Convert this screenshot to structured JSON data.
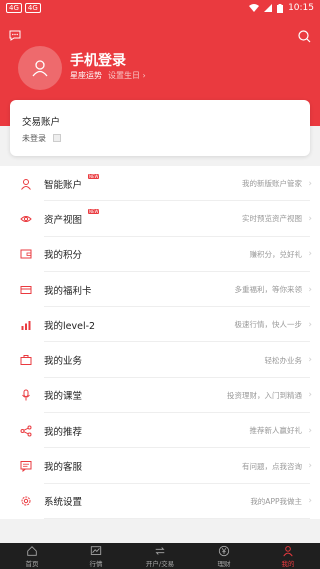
{
  "statusbar": {
    "left_badges": [
      "4G",
      "4G"
    ],
    "time": "10:15"
  },
  "profile": {
    "login_title": "手机登录",
    "horoscope_label": "星座运势",
    "birthday_link": "设置生日"
  },
  "account": {
    "title": "交易账户",
    "status": "未登录"
  },
  "menu": [
    {
      "label": "智能账户",
      "desc": "我的新版账户管家",
      "icon": "person-icon",
      "badge": "NEW"
    },
    {
      "label": "资产视图",
      "desc": "实时预览资产视图",
      "icon": "eye-icon",
      "badge": "NEW"
    },
    {
      "label": "我的积分",
      "desc": "赚积分，兑好礼",
      "icon": "wallet-icon"
    },
    {
      "label": "我的福利卡",
      "desc": "多重福利，等你来领",
      "icon": "card-icon"
    },
    {
      "label": "我的level-2",
      "desc": "极速行情，快人一步",
      "icon": "bar-chart-icon"
    },
    {
      "label": "我的业务",
      "desc": "轻松办业务",
      "icon": "briefcase-icon"
    },
    {
      "label": "我的课堂",
      "desc": "投资理财，入门到精通",
      "icon": "microphone-icon"
    },
    {
      "label": "我的推荐",
      "desc": "推荐新人赢好礼",
      "icon": "share-icon"
    },
    {
      "label": "我的客服",
      "desc": "有问题，点我咨询",
      "icon": "message-icon"
    },
    {
      "label": "系统设置",
      "desc": "我的APP我做主",
      "icon": "gear-icon"
    }
  ],
  "tabs": [
    {
      "label": "首页",
      "icon": "home-icon"
    },
    {
      "label": "行情",
      "icon": "chart-icon"
    },
    {
      "label": "开户/交易",
      "icon": "exchange-icon"
    },
    {
      "label": "理财",
      "icon": "yen-icon"
    },
    {
      "label": "我的",
      "icon": "person-icon",
      "active": true
    }
  ],
  "colors": {
    "brand_red": "#ea3a3f",
    "tabbar_bg": "#1f1f1f"
  }
}
